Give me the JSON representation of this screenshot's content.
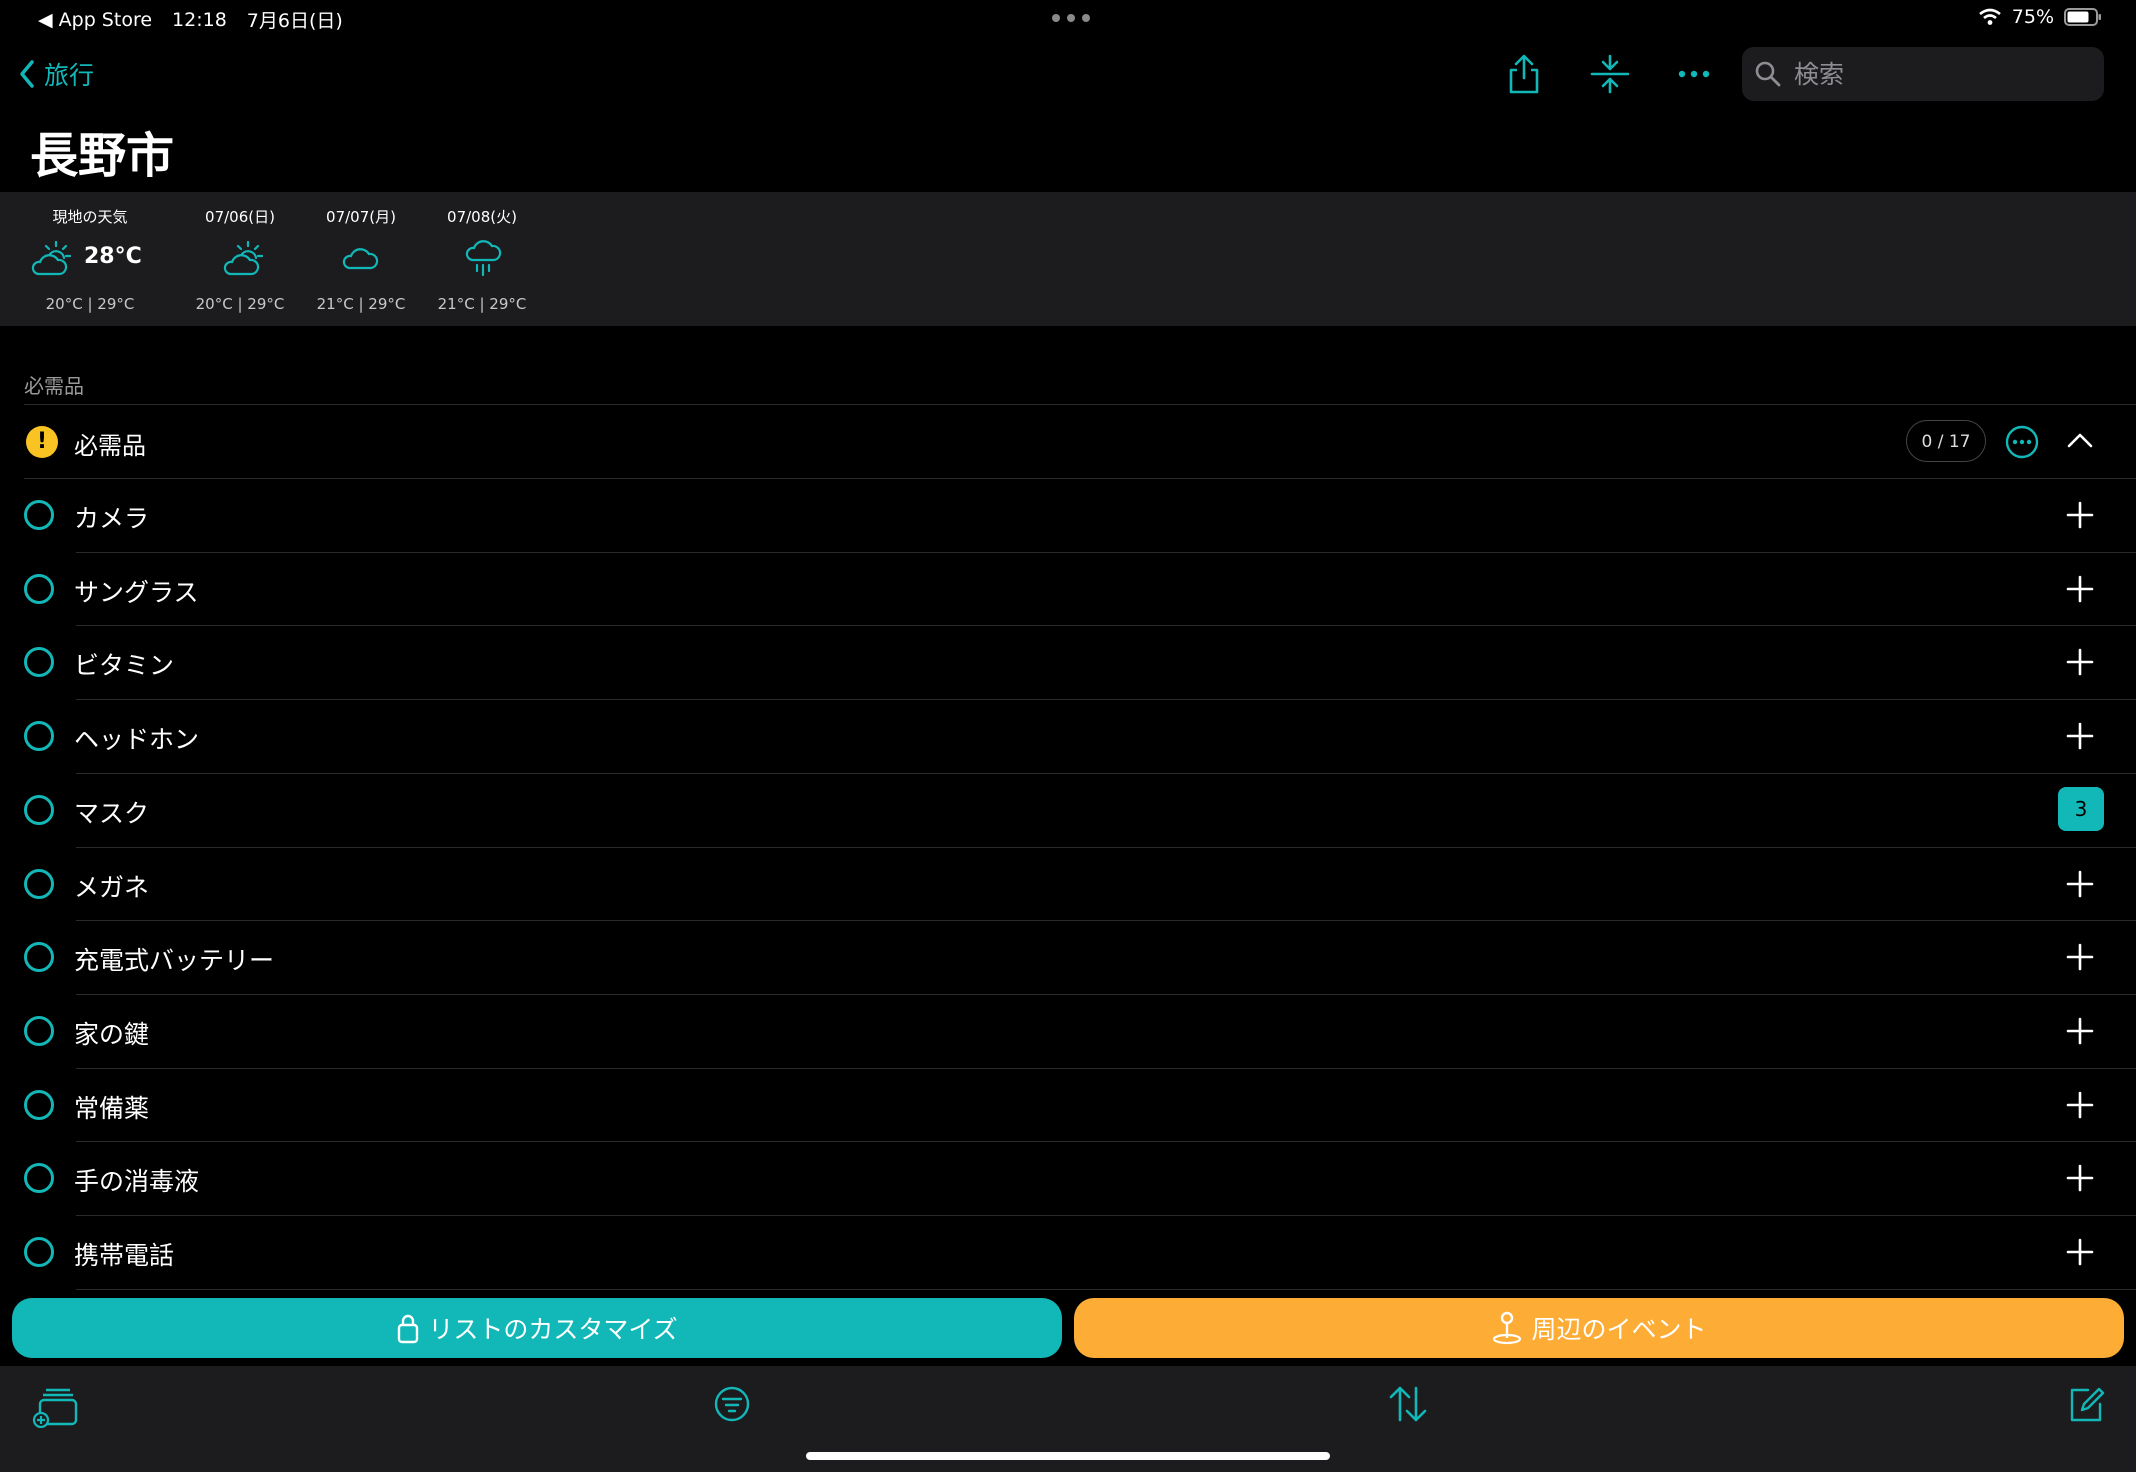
{
  "status_bar": {
    "back_app": "◀ App Store",
    "time": "12:18",
    "date": "7月6日(日)",
    "battery": "75%"
  },
  "nav": {
    "back_label": "旅行",
    "search_placeholder": "検索"
  },
  "page": {
    "title": "長野市"
  },
  "weather": {
    "current": {
      "label": "現地の天気",
      "icon": "partly-cloudy-icon",
      "temp": "28°C",
      "range": "20°C | 29°C"
    },
    "forecast": [
      {
        "date": "07/06(日)",
        "icon": "partly-cloudy-icon",
        "range": "20°C | 29°C"
      },
      {
        "date": "07/07(月)",
        "icon": "cloud-icon",
        "range": "21°C | 29°C"
      },
      {
        "date": "07/08(火)",
        "icon": "rain-icon",
        "range": "21°C | 29°C"
      }
    ]
  },
  "section": {
    "title": "必需品",
    "group": {
      "label": "必需品",
      "counter": "0 / 17"
    },
    "items": [
      {
        "label": "カメラ"
      },
      {
        "label": "サングラス"
      },
      {
        "label": "ビタミン"
      },
      {
        "label": "ヘッドホン"
      },
      {
        "label": "マスク",
        "badge": "3"
      },
      {
        "label": "メガネ"
      },
      {
        "label": "充電式バッテリー"
      },
      {
        "label": "家の鍵"
      },
      {
        "label": "常備薬"
      },
      {
        "label": "手の消毒液"
      },
      {
        "label": "携帯電話"
      }
    ]
  },
  "actions": {
    "customize_label": "リストのカスタマイズ",
    "events_label": "周辺のイベント"
  },
  "colors": {
    "accent": "#12b8b8",
    "orange": "#fdac35",
    "warning": "#f9c423",
    "bar": "#1c1c1e"
  }
}
